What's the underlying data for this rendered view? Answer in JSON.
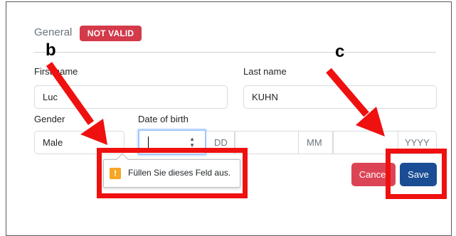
{
  "section": {
    "title": "General",
    "badge": "NOT VALID"
  },
  "fields": {
    "first_name": {
      "label": "First name",
      "value": "Luc"
    },
    "last_name": {
      "label": "Last name",
      "value": "KUHN"
    },
    "gender": {
      "label": "Gender",
      "value": "Male"
    },
    "dob": {
      "label": "Date of birth",
      "day_value": "",
      "day_placeholder": "DD",
      "month_placeholder": "MM",
      "year_placeholder": "YYYY"
    }
  },
  "validation": {
    "message": "Füllen Sie dieses Feld aus.",
    "icon": "warning-icon"
  },
  "buttons": {
    "cancel": "Cancel",
    "save": "Save"
  },
  "annotations": {
    "b": "b",
    "c": "c"
  },
  "colors": {
    "badge": "#d33a4a",
    "cancel": "#dc4456",
    "save": "#1a4d93",
    "highlight": "#ef1010",
    "arrow": "#ef1010"
  }
}
